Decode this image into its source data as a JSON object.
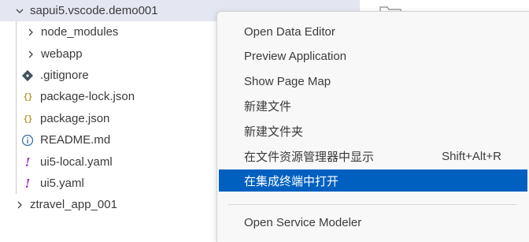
{
  "explorer": {
    "root": {
      "label": "sapui5.vscode.demo001"
    },
    "items": [
      {
        "label": "node_modules",
        "kind": "folder"
      },
      {
        "label": "webapp",
        "kind": "folder"
      },
      {
        "label": ".gitignore",
        "kind": "git"
      },
      {
        "label": "package-lock.json",
        "kind": "json",
        "icon_text": "{}"
      },
      {
        "label": "package.json",
        "kind": "json",
        "icon_text": "{}"
      },
      {
        "label": "README.md",
        "kind": "info"
      },
      {
        "label": "ui5-local.yaml",
        "kind": "yaml",
        "icon_text": "!"
      },
      {
        "label": "ui5.yaml",
        "kind": "yaml",
        "icon_text": "!"
      }
    ],
    "sibling": {
      "label": "ztravel_app_001"
    }
  },
  "context_menu": {
    "items": [
      {
        "label": "Open Data Editor"
      },
      {
        "label": "Preview Application"
      },
      {
        "label": "Show Page Map"
      },
      {
        "label": "新建文件"
      },
      {
        "label": "新建文件夹"
      },
      {
        "label": "在文件资源管理器中显示",
        "shortcut": "Shift+Alt+R"
      },
      {
        "label": "在集成终端中打开",
        "active": true
      },
      {
        "label": "Open Service Modeler"
      }
    ]
  },
  "colors": {
    "selected_row": "#e4e6f1",
    "menu_highlight": "#0060c0",
    "json_icon": "#b8a13a",
    "yaml_icon": "#a031c9"
  }
}
